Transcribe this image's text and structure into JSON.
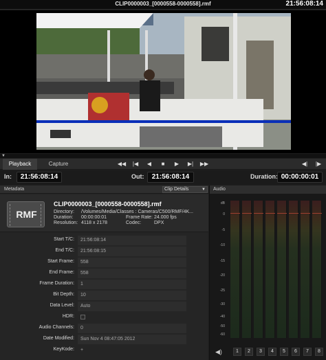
{
  "titlebar": {
    "title": "CLIP0000003_[0000558-0000558].rmf",
    "clock": "21:56:08:14"
  },
  "tabs": [
    {
      "label": "Playback"
    },
    {
      "label": "Capture"
    }
  ],
  "transport": {
    "icons": [
      "rewind-icon",
      "step-start-icon",
      "step-back-icon",
      "stop-icon",
      "play-icon",
      "step-forward-icon",
      "fast-forward-icon"
    ],
    "right_icons": [
      "mark-in-icon",
      "mark-out-icon"
    ],
    "glyphs": [
      "◀◀",
      "|◀",
      "◀",
      "■",
      "▶",
      "▶|",
      "▶▶"
    ],
    "right_glyphs": [
      "◀|",
      "|▶"
    ]
  },
  "timecodes": {
    "in_label": "In:",
    "in_value": "21:56:08:14",
    "out_label": "Out:",
    "out_value": "21:56:08:14",
    "duration_label": "Duration:",
    "duration_value": "00:00:00:01"
  },
  "metadata": {
    "header": "Metadata",
    "selector": "Clip Details",
    "icon_text": "RMF",
    "clip_name": "CLIP0000003_[0000558-0000558].rmf",
    "details": {
      "directory_label": "Directory:",
      "directory_value": "/Volumes/Media/Classes : Cameras/C500/RMF/4K...",
      "duration_label": "Duration:",
      "duration_value": "00:00:00:01",
      "frame_rate_label": "Frame Rate:",
      "frame_rate_value": "24.000 fps",
      "resolution_label": "Resolution:",
      "resolution_value": "4118 x 2178",
      "codec_label": "Codec:",
      "codec_value": "DPX"
    },
    "fields": [
      {
        "label": "Start T/C:",
        "value": "21:56:08:14"
      },
      {
        "label": "End T/C:",
        "value": "21:56:08:15"
      },
      {
        "label": "Start Frame:",
        "value": "558"
      },
      {
        "label": "End Frame:",
        "value": "558"
      },
      {
        "label": "Frame Duration:",
        "value": "1"
      },
      {
        "label": "Bit Depth:",
        "value": "10"
      },
      {
        "label": "Data Level:",
        "value": "Auto"
      },
      {
        "label": "HDR:",
        "value": ""
      },
      {
        "label": "Audio Channels:",
        "value": "0"
      },
      {
        "label": "Date Modified:",
        "value": "Sun Nov  4 08:47:05 2012"
      },
      {
        "label": "KeyKode:",
        "value": "+"
      }
    ]
  },
  "audio": {
    "header": "Audio",
    "db_labels": [
      "dB",
      "0",
      "-5",
      "-10",
      "-15",
      "-20",
      "-25",
      "-30",
      "-40",
      "-50",
      "-60"
    ],
    "channels": [
      "1",
      "2",
      "3",
      "4",
      "5",
      "6",
      "7",
      "8"
    ],
    "speaker_glyph": "◀)"
  },
  "colors": {
    "accent_blue": "#0a2fb8",
    "panel": "#252525",
    "meter_line": "#a04030"
  }
}
